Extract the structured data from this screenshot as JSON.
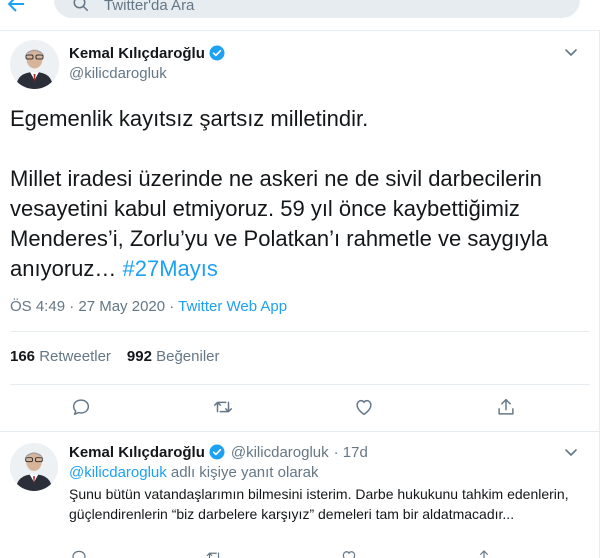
{
  "search": {
    "placeholder": "Twitter'da Ara"
  },
  "tweet": {
    "author": {
      "name": "Kemal Kılıçdaroğlu",
      "handle": "@kilicdarogluk",
      "verified": true
    },
    "text_line1": "Egemenlik kayıtsız şartsız milletindir.",
    "text_para2": "Millet iradesi üzerinde ne askeri ne de sivil darbecilerin vesayetini kabul etmiyoruz. 59 yıl önce kaybettiğimiz Menderes’i, Zorlu’yu ve Polatkan’ı rahmetle ve saygıyla anıyoruz… ",
    "hashtag": "#27Mayıs",
    "timestamp": "ÖS 4:49 · 27 May 2020 · ",
    "source_app": "Twitter Web App",
    "retweet_count": "166",
    "retweet_label": "Retweetler",
    "like_count": "992",
    "like_label": "Beğeniler"
  },
  "reply": {
    "author": {
      "name": "Kemal Kılıçdaroğlu",
      "handle": "@kilicdarogluk",
      "time": "· 17d",
      "verified": true
    },
    "replying_mention": "@kilicdarogluk",
    "replying_suffix": " adlı kişiye yanıt olarak",
    "text": "Şunu bütün vatandaşlarımın bilmesini isterim. Darbe hukukunu tahkim edenlerin, güçlendirenlerin “biz darbelere karşıyız” demeleri tam bir aldatmacadır..."
  },
  "icons": {
    "back": "back-arrow-icon",
    "search": "search-icon",
    "verified": "verified-badge-icon",
    "more": "chevron-down-icon",
    "reply": "reply-icon",
    "retweet": "retweet-icon",
    "like": "heart-icon",
    "share": "share-icon"
  },
  "colors": {
    "accent": "#1da1f2",
    "muted": "#657786",
    "text": "#14171a",
    "border": "#e6ecf0"
  }
}
